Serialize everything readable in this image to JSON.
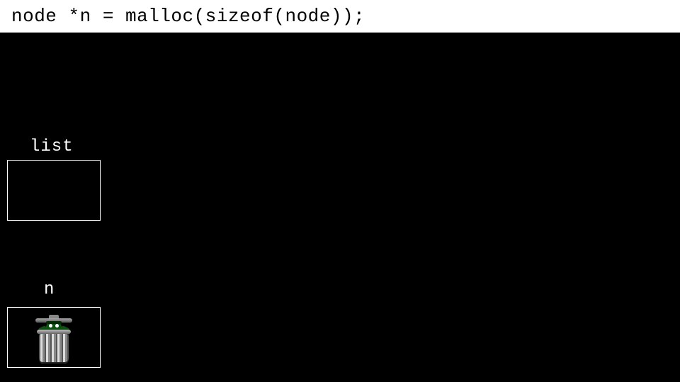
{
  "code_line": "node *n = malloc(sizeof(node));",
  "labels": {
    "list": "list",
    "n": "n"
  },
  "icon_names": {
    "garbage": "oscar-garbage-icon"
  }
}
